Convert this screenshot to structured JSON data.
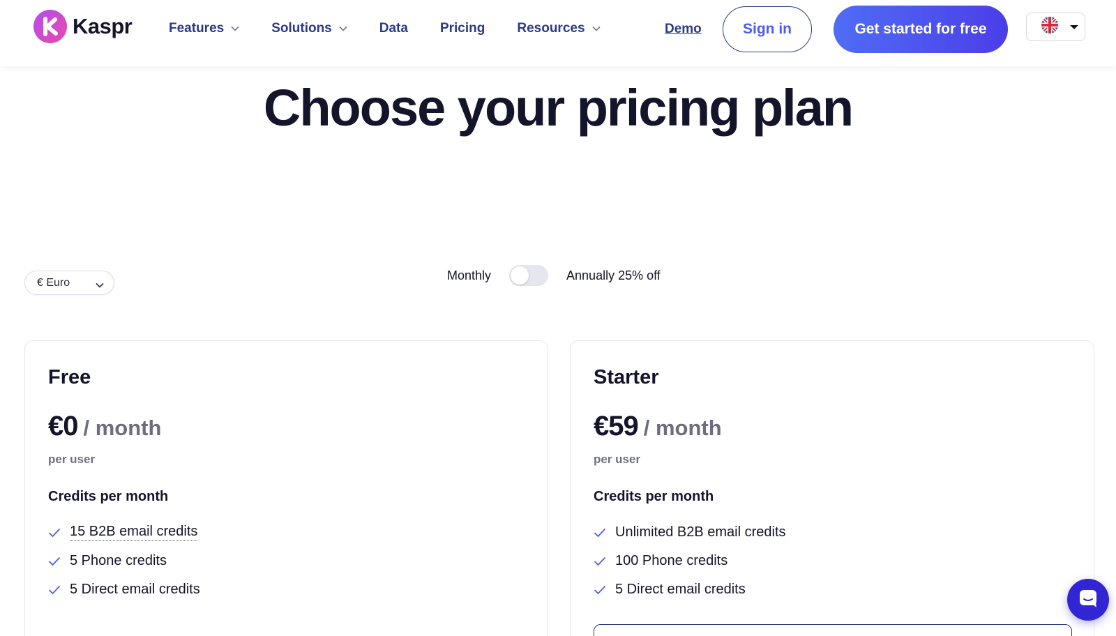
{
  "header": {
    "brand": "Kaspr",
    "nav": [
      {
        "label": "Features",
        "dropdown": true
      },
      {
        "label": "Solutions",
        "dropdown": true
      },
      {
        "label": "Data",
        "dropdown": false
      },
      {
        "label": "Pricing",
        "dropdown": false
      },
      {
        "label": "Resources",
        "dropdown": true
      }
    ],
    "demo_label": "Demo",
    "signin_label": "Sign in",
    "cta_label": "Get started for free",
    "language_icon": "uk-flag-icon"
  },
  "hero": {
    "title": "Choose your pricing plan"
  },
  "controls": {
    "currency_value": "€ Euro",
    "monthly_label": "Monthly",
    "annual_label": "Annually 25% off",
    "annual_selected": false
  },
  "plans": [
    {
      "name": "Free",
      "price": "€0",
      "period": "/ month",
      "per_user": "per user",
      "credits_title": "Credits per month",
      "features": [
        "15 B2B email credits",
        "5 Phone credits",
        "5 Direct email credits"
      ]
    },
    {
      "name": "Starter",
      "price": "€59",
      "period": "/ month",
      "per_user": "per user",
      "credits_title": "Credits per month",
      "features": [
        "Unlimited B2B email credits",
        "100 Phone credits",
        "5 Direct email credits"
      ]
    }
  ],
  "colors": {
    "brand_gradient_start": "#b44cf0",
    "brand_gradient_end": "#e94aa8",
    "nav_text": "#2a3a86",
    "cta_start": "#4f6df5",
    "cta_end": "#4b3ee8",
    "check": "#4a5cf2",
    "chat": "#3125d4"
  }
}
